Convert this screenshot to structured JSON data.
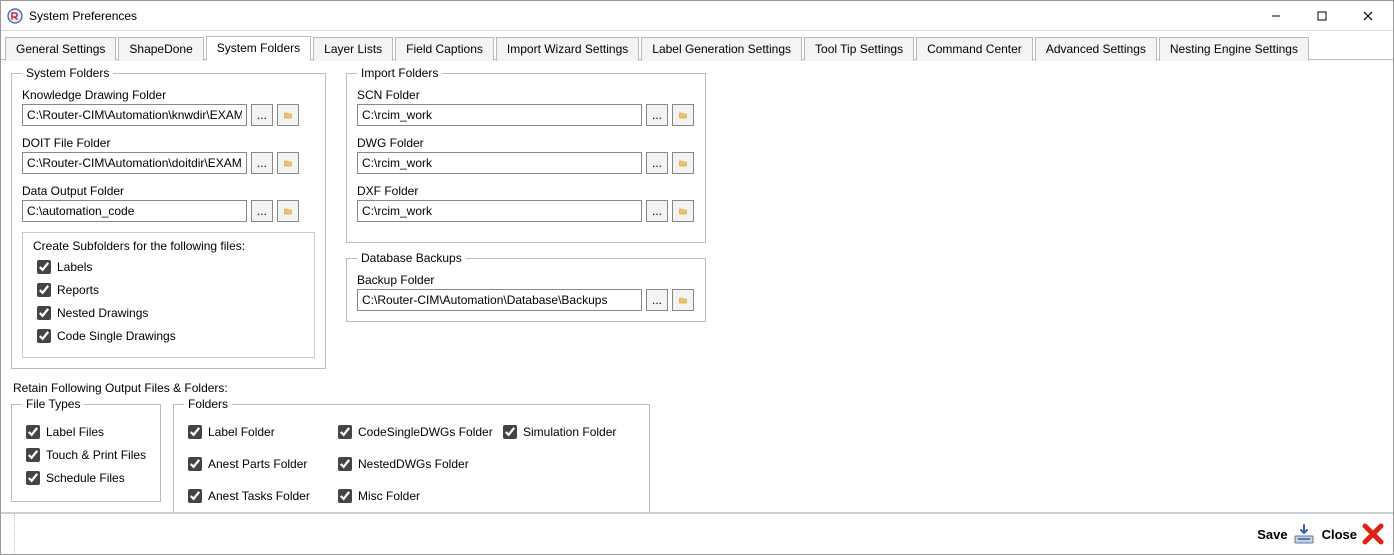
{
  "window": {
    "title": "System Preferences"
  },
  "tabs": [
    "General Settings",
    "ShapeDone",
    "System Folders",
    "Layer Lists",
    "Field Captions",
    "Import Wizard Settings",
    "Label Generation Settings",
    "Tool Tip Settings",
    "Command Center",
    "Advanced Settings",
    "Nesting Engine Settings"
  ],
  "active_tab_index": 2,
  "system_folders": {
    "legend": "System Folders",
    "knowledge": {
      "label": "Knowledge Drawing Folder",
      "value": "C:\\Router-CIM\\Automation\\knwdir\\EXAMPLES"
    },
    "doit": {
      "label": "DOIT File Folder",
      "value": "C:\\Router-CIM\\Automation\\doitdir\\EXAMPLES"
    },
    "data_output": {
      "label": "Data Output Folder",
      "value": "C:\\automation_code"
    },
    "subfolders": {
      "title": "Create Subfolders for the following files:",
      "labels": "Labels",
      "reports": "Reports",
      "nested": "Nested Drawings",
      "code_single": "Code Single Drawings"
    }
  },
  "import_folders": {
    "legend": "Import Folders",
    "scn": {
      "label": "SCN Folder",
      "value": "C:\\rcim_work"
    },
    "dwg": {
      "label": "DWG Folder",
      "value": "C:\\rcim_work"
    },
    "dxf": {
      "label": "DXF Folder",
      "value": "C:\\rcim_work"
    }
  },
  "database_backups": {
    "legend": "Database Backups",
    "backup": {
      "label": "Backup Folder",
      "value": "C:\\Router-CIM\\Automation\\Database\\Backups"
    }
  },
  "retain": {
    "title": "Retain Following Output Files & Folders:",
    "file_types": {
      "legend": "File Types",
      "label_files": "Label Files",
      "touch_print": "Touch & Print Files",
      "schedule": "Schedule Files"
    },
    "folders": {
      "legend": "Folders",
      "label_folder": "Label Folder",
      "anest_parts": "Anest Parts Folder",
      "anest_tasks": "Anest Tasks Folder",
      "codesingle": "CodeSingleDWGs Folder",
      "nesteddwgs": "NestedDWGs Folder",
      "misc": "Misc Folder",
      "simulation": "Simulation Folder"
    }
  },
  "buttons": {
    "ellipsis": "...",
    "save": "Save",
    "close": "Close"
  }
}
